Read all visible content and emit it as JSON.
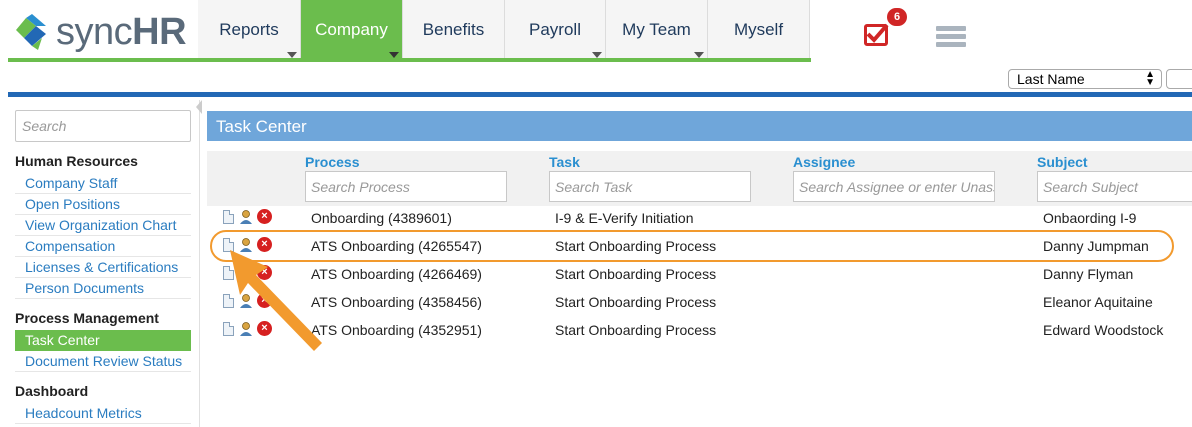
{
  "logo": {
    "text_a": "sync",
    "text_b": "HR"
  },
  "nav": {
    "tabs": [
      {
        "label": "Reports",
        "has_caret": true,
        "active": false
      },
      {
        "label": "Company",
        "has_caret": true,
        "active": true
      },
      {
        "label": "Benefits",
        "has_caret": false,
        "active": false
      },
      {
        "label": "Payroll",
        "has_caret": true,
        "active": false
      },
      {
        "label": "My Team",
        "has_caret": true,
        "active": false
      },
      {
        "label": "Myself",
        "has_caret": false,
        "active": false
      }
    ]
  },
  "tasks_badge": {
    "count": "6",
    "icon": "checkbox-check-icon"
  },
  "menu_icon": "server-list-icon",
  "sort": {
    "selected": "Last Name"
  },
  "sidebar": {
    "search_placeholder": "Search",
    "sections": [
      {
        "heading": "Human Resources",
        "items": [
          "Company Staff",
          "Open Positions",
          "View Organization Chart",
          "Compensation",
          "Licenses & Certifications",
          "Person Documents"
        ]
      },
      {
        "heading": "Process Management",
        "items": [
          "Task Center",
          "Document Review Status"
        ],
        "active_item": "Task Center"
      },
      {
        "heading": "Dashboard",
        "items": [
          "Headcount Metrics"
        ]
      }
    ]
  },
  "panel": {
    "title": "Task Center"
  },
  "grid": {
    "columns": [
      {
        "label": "Process",
        "placeholder": "Search Process"
      },
      {
        "label": "Task",
        "placeholder": "Search Task"
      },
      {
        "label": "Assignee",
        "placeholder": "Search Assignee or enter Unassigned"
      },
      {
        "label": "Subject",
        "placeholder": "Search Subject"
      }
    ],
    "rows": [
      {
        "process": "Onboarding (4389601)",
        "task": "I-9 & E-Verify Initiation",
        "assignee": "",
        "subject": "Onbaording I-9"
      },
      {
        "process": "ATS Onboarding (4265547)",
        "task": "Start Onboarding Process",
        "assignee": "",
        "subject": "Danny Jumpman"
      },
      {
        "process": "ATS Onboarding (4266469)",
        "task": "Start Onboarding Process",
        "assignee": "",
        "subject": "Danny Flyman"
      },
      {
        "process": "ATS Onboarding (4358456)",
        "task": "Start Onboarding Process",
        "assignee": "",
        "subject": "Eleanor Aquitaine"
      },
      {
        "process": "ATS Onboarding (4352951)",
        "task": "Start Onboarding Process",
        "assignee": "",
        "subject": "Edward Woodstock"
      }
    ],
    "highlighted_row": 1
  },
  "colors": {
    "green": "#6bbd4d",
    "blue": "#2268b5",
    "panel": "#6fa6da",
    "link": "#2a7cc0",
    "annotation": "#f29a2e"
  }
}
